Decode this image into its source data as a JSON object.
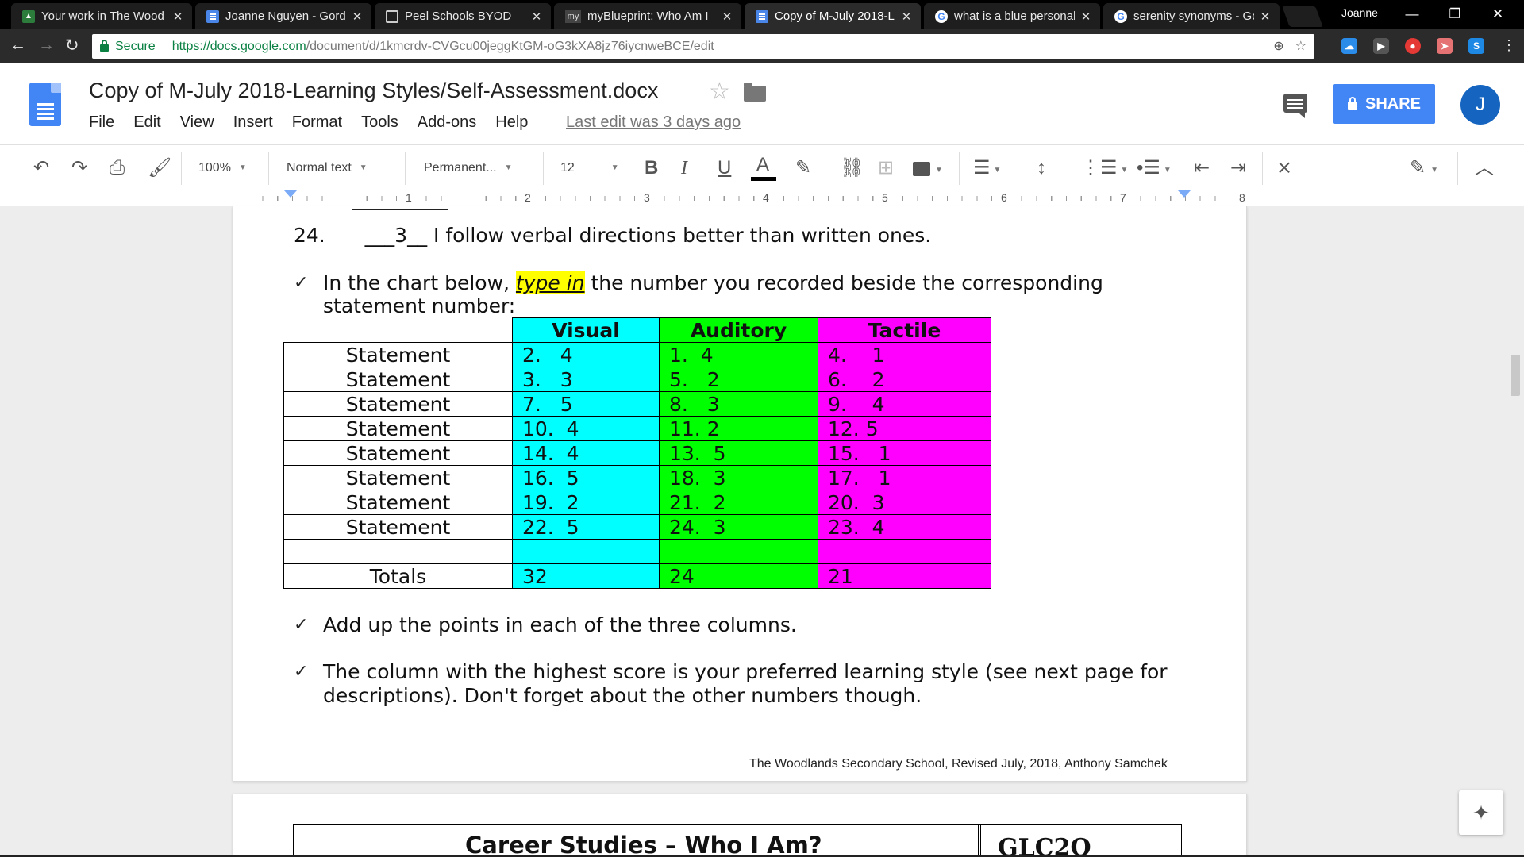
{
  "browser": {
    "tabs": [
      {
        "title": "Your work in The Wood",
        "icon": "classroom-icon"
      },
      {
        "title": "Joanne Nguyen - Gord",
        "icon": "docs-icon"
      },
      {
        "title": "Peel Schools BYOD",
        "icon": "page-icon"
      },
      {
        "title": "myBlueprint: Who Am I",
        "icon": "my-icon",
        "favicon_text": "my"
      },
      {
        "title": "Copy of M-July 2018-L",
        "icon": "docs-icon",
        "active": true
      },
      {
        "title": "what is a blue personal",
        "icon": "google-icon"
      },
      {
        "title": "serenity synonyms - Go",
        "icon": "google-icon"
      }
    ],
    "profile_name": "Joanne",
    "secure_label": "Secure",
    "url_host": "https://docs.google.com",
    "url_path": "/document/d/1kmcrdv-CVGcu00jeggKtGM-oG3kXA8jz76iycnweBCE/edit"
  },
  "docs": {
    "title": "Copy of M-July 2018-Learning Styles/Self-Assessment.docx",
    "menu": [
      "File",
      "Edit",
      "View",
      "Insert",
      "Format",
      "Tools",
      "Add-ons",
      "Help"
    ],
    "last_edit": "Last edit was 3 days ago",
    "share_label": "SHARE",
    "avatar_letter": "J"
  },
  "format_toolbar": {
    "zoom": "100%",
    "style": "Normal text",
    "font": "Permanent...",
    "font_size": "12"
  },
  "ruler": {
    "numbers": [
      "1",
      "2",
      "3",
      "4",
      "5",
      "6",
      "7",
      "8"
    ]
  },
  "document": {
    "item24": {
      "number": "24.",
      "blank_value": "3",
      "text": "I follow verbal directions better than written ones."
    },
    "instruction1_before": "In the chart below, ",
    "instruction1_highlight": "type in",
    "instruction1_after": " the number you recorded beside the corresponding",
    "instruction1_line2": "statement number:",
    "table": {
      "headers": [
        "Visual",
        "Auditory",
        "Tactile"
      ],
      "rows": [
        {
          "label": "Statement",
          "visual": "2.   4",
          "auditory": "1.  4",
          "tactile": "4.    1"
        },
        {
          "label": "Statement",
          "visual": "3.   3",
          "auditory": "5.   2",
          "tactile": "6.    2"
        },
        {
          "label": "Statement",
          "visual": "7.   5",
          "auditory": "8.   3",
          "tactile": "9.    4"
        },
        {
          "label": "Statement",
          "visual": "10.  4",
          "auditory": "11. 2",
          "tactile": "12. 5"
        },
        {
          "label": "Statement",
          "visual": "14.  4",
          "auditory": "13.  5",
          "tactile": "15.   1"
        },
        {
          "label": "Statement",
          "visual": "16.  5",
          "auditory": "18.  3",
          "tactile": "17.   1"
        },
        {
          "label": "Statement",
          "visual": "19.  2",
          "auditory": "21.  2",
          "tactile": "20.  3"
        },
        {
          "label": "Statement",
          "visual": "22.  5",
          "auditory": "24.  3",
          "tactile": "23.  4"
        }
      ],
      "totals_label": "Totals",
      "totals": {
        "visual": "32",
        "auditory": "24",
        "tactile": "21"
      }
    },
    "instruction2": "Add up the points in each of the three columns.",
    "instruction3_line1": "The column with the highest score is your preferred learning style (see next page for",
    "instruction3_line2": "descriptions).  Don't forget about the other numbers though.",
    "check_mark": "✓",
    "footer": "The Woodlands Secondary School, Revised July, 2018, Anthony Samchek",
    "page2_title": "Career Studies – Who I Am?",
    "page2_code": "GLC2O"
  },
  "colors": {
    "visual": "#00ffff",
    "auditory": "#00ff00",
    "tactile": "#ff00ff",
    "highlight": "#ffff00",
    "share_button": "#4285f4"
  }
}
